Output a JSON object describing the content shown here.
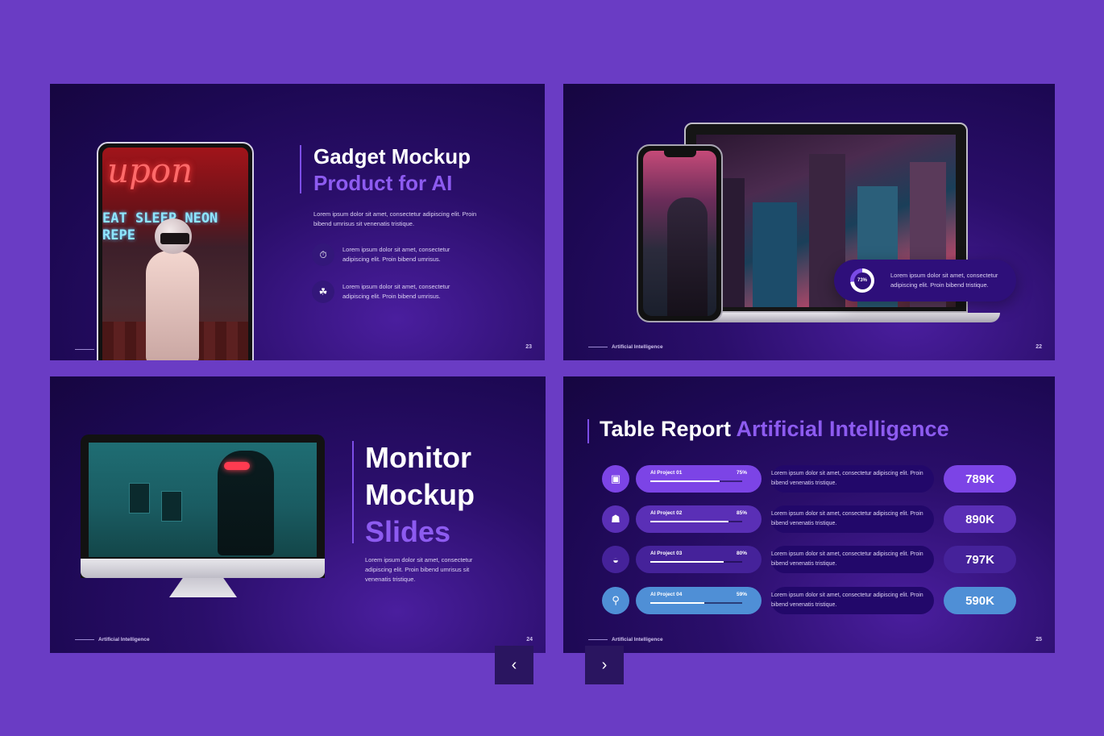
{
  "slides": [
    {
      "number": "23",
      "title_line1": "Gadget Mockup",
      "title_line2": "Product for AI",
      "description": "Lorem ipsum dolor sit amet, consectetur adipiscing elit. Proin bibend umrisus sit  venenatis tristique.",
      "features": [
        {
          "icon": "stopwatch-icon",
          "glyph": "⏱",
          "text": "Lorem ipsum dolor sit amet, consectetur adipiscing elit. Proin bibend umrisus."
        },
        {
          "icon": "network-icon",
          "glyph": "☘",
          "text": "Lorem ipsum dolor sit amet, consectetur adipiscing elit. Proin bibend umrisus."
        }
      ],
      "image_neon_top": "upon",
      "image_neon_side": "EAT SLEEP NEON REPE"
    },
    {
      "number": "22",
      "footer": "Artificial Intelligence",
      "stat_percent": 73,
      "stat_label": "73%",
      "stat_text": "Lorem ipsum dolor sit amet, consectetur adipiscing elit. Proin bibend tristique."
    },
    {
      "number": "24",
      "footer": "Artificial Intelligence",
      "title_line1": "Monitor",
      "title_line2": "Mockup",
      "title_line3": "Slides",
      "description": "Lorem ipsum dolor sit amet, consectetur adipiscing elit. Proin bibend umrisus sit venenatis tristique."
    },
    {
      "number": "25",
      "footer": "Artificial Intelligence",
      "title_main": "Table Report",
      "title_accent": "Artificial Intelligence",
      "rows": [
        {
          "name": "AI Project 01",
          "percent_label": "75%",
          "percent": 75,
          "text": "Lorem ipsum dolor sit amet, consectetur adipiscing elit. Proin bibend venenatis tristique.",
          "value": "789K",
          "color": "#7c44e6",
          "icon": "chip-icon",
          "glyph": "▣"
        },
        {
          "name": "AI Project 02",
          "percent_label": "85%",
          "percent": 85,
          "text": "Lorem ipsum dolor sit amet, consectetur adipiscing elit. Proin bibend venenatis tristique.",
          "value": "890K",
          "color": "#5a2fb6",
          "icon": "robot-icon",
          "glyph": "☗"
        },
        {
          "name": "AI Project 03",
          "percent_label": "80%",
          "percent": 80,
          "text": "Lorem ipsum dolor sit amet, consectetur adipiscing elit. Proin bibend venenatis tristique.",
          "value": "797K",
          "color": "#45229a",
          "icon": "vr-headset-icon",
          "glyph": "◒"
        },
        {
          "name": "AI Project 04",
          "percent_label": "59%",
          "percent": 59,
          "text": "Lorem ipsum dolor sit amet, consectetur adipiscing elit. Proin bibend venenatis tristique.",
          "value": "590K",
          "color": "#4f8fd6",
          "icon": "antenna-icon",
          "glyph": "⚲"
        }
      ]
    }
  ],
  "nav": {
    "prev": "‹",
    "next": "›"
  }
}
